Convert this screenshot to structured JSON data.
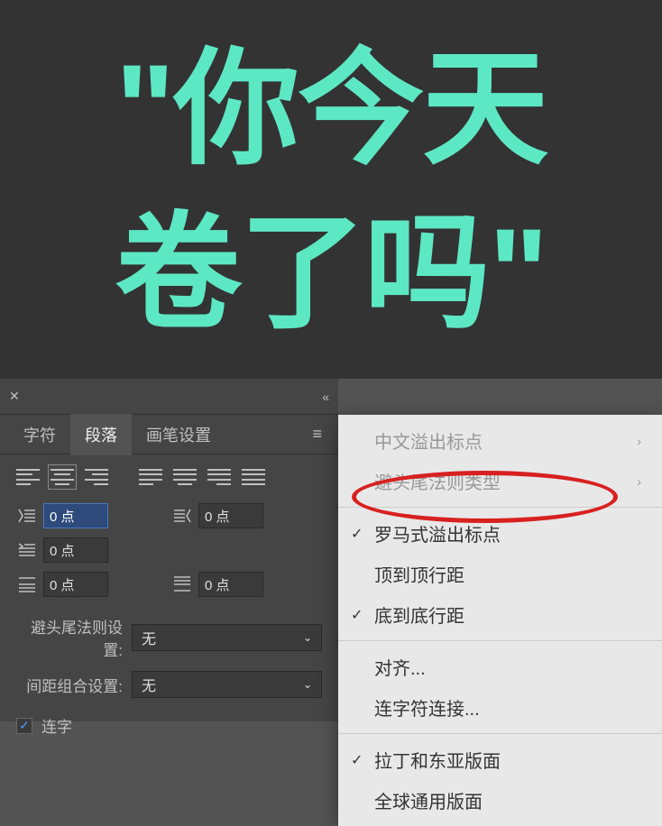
{
  "canvas": {
    "text_line1": "\"你今天",
    "text_line2": "卷了吗\""
  },
  "panel": {
    "tabs": {
      "character": "字符",
      "paragraph": "段落",
      "brush": "画笔设置"
    },
    "inputs": {
      "indent_left": "0 点",
      "indent_right": "0 点",
      "first_line": "0 点",
      "space_before": "0 点",
      "space_after": "0 点"
    },
    "kinsoku_label": "避头尾法则设置:",
    "kinsoku_value": "无",
    "mojikumi_label": "间距组合设置:",
    "mojikumi_value": "无",
    "hyphenate_label": "连字"
  },
  "menu": {
    "cjk_hanging": "中文溢出标点",
    "kinsoku_type": "避头尾法则类型",
    "roman_hanging": "罗马式溢出标点",
    "top_to_top": "顶到顶行距",
    "bottom_to_bottom": "底到底行距",
    "justification": "对齐...",
    "hyphenation": "连字符连接...",
    "latin_east": "拉丁和东亚版面",
    "world_ready": "全球通用版面"
  }
}
